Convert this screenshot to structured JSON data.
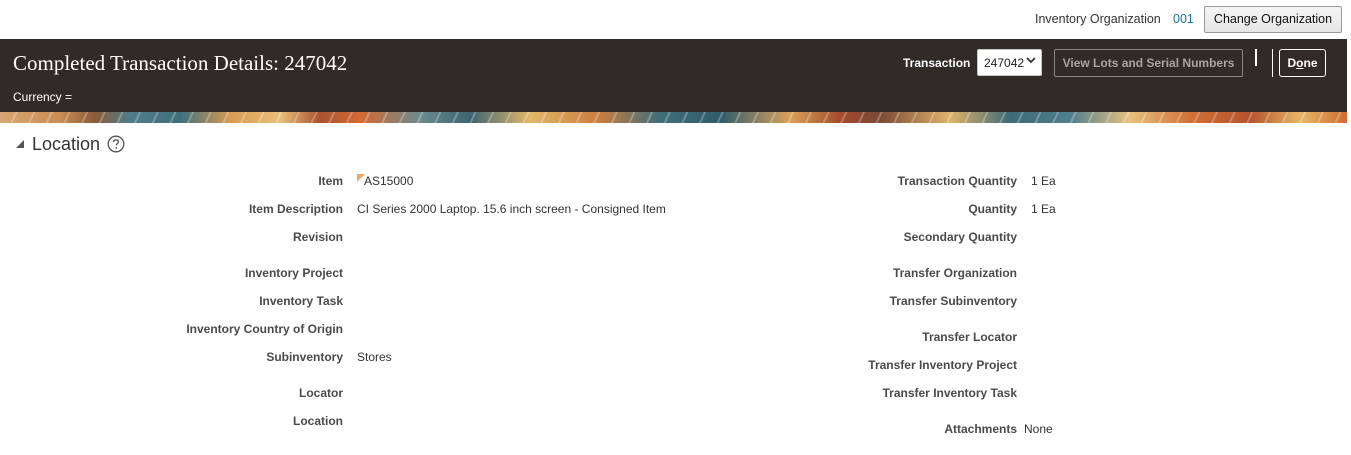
{
  "org_bar": {
    "label": "Inventory Organization",
    "value": "001",
    "change_button": "Change Organization"
  },
  "header": {
    "title": "Completed Transaction Details: 247042",
    "currency_label": "Currency =",
    "transaction_label": "Transaction",
    "transaction_selected": "247042",
    "view_lots_button": "View Lots and Serial Numbers",
    "done_button_prefix": "D",
    "done_button_underlined": "o",
    "done_button_suffix": "ne"
  },
  "section": {
    "title": "Location"
  },
  "left_fields": {
    "item": {
      "label": "Item",
      "value": "AS15000"
    },
    "item_description": {
      "label": "Item Description",
      "value": "CI Series 2000 Laptop. 15.6 inch screen - Consigned Item"
    },
    "revision": {
      "label": "Revision",
      "value": ""
    },
    "inventory_project": {
      "label": "Inventory Project",
      "value": ""
    },
    "inventory_task": {
      "label": "Inventory Task",
      "value": ""
    },
    "inventory_country_of_origin": {
      "label": "Inventory Country of Origin",
      "value": ""
    },
    "subinventory": {
      "label": "Subinventory",
      "value": "Stores"
    },
    "locator": {
      "label": "Locator",
      "value": ""
    },
    "location": {
      "label": "Location",
      "value": ""
    }
  },
  "right_fields": {
    "transaction_quantity": {
      "label": "Transaction Quantity",
      "value": "1 Ea"
    },
    "quantity": {
      "label": "Quantity",
      "value": "1 Ea"
    },
    "secondary_quantity": {
      "label": "Secondary Quantity",
      "value": ""
    },
    "transfer_organization": {
      "label": "Transfer Organization",
      "value": ""
    },
    "transfer_subinventory": {
      "label": "Transfer Subinventory",
      "value": ""
    },
    "transfer_locator": {
      "label": "Transfer Locator",
      "value": ""
    },
    "transfer_inventory_project": {
      "label": "Transfer Inventory Project",
      "value": ""
    },
    "transfer_inventory_task": {
      "label": "Transfer Inventory Task",
      "value": ""
    },
    "attachments": {
      "label": "Attachments",
      "value": "None"
    }
  },
  "colors": {
    "header_bg": "#302b27",
    "link": "#1f6f9f",
    "label_text": "#4a4a4a"
  }
}
